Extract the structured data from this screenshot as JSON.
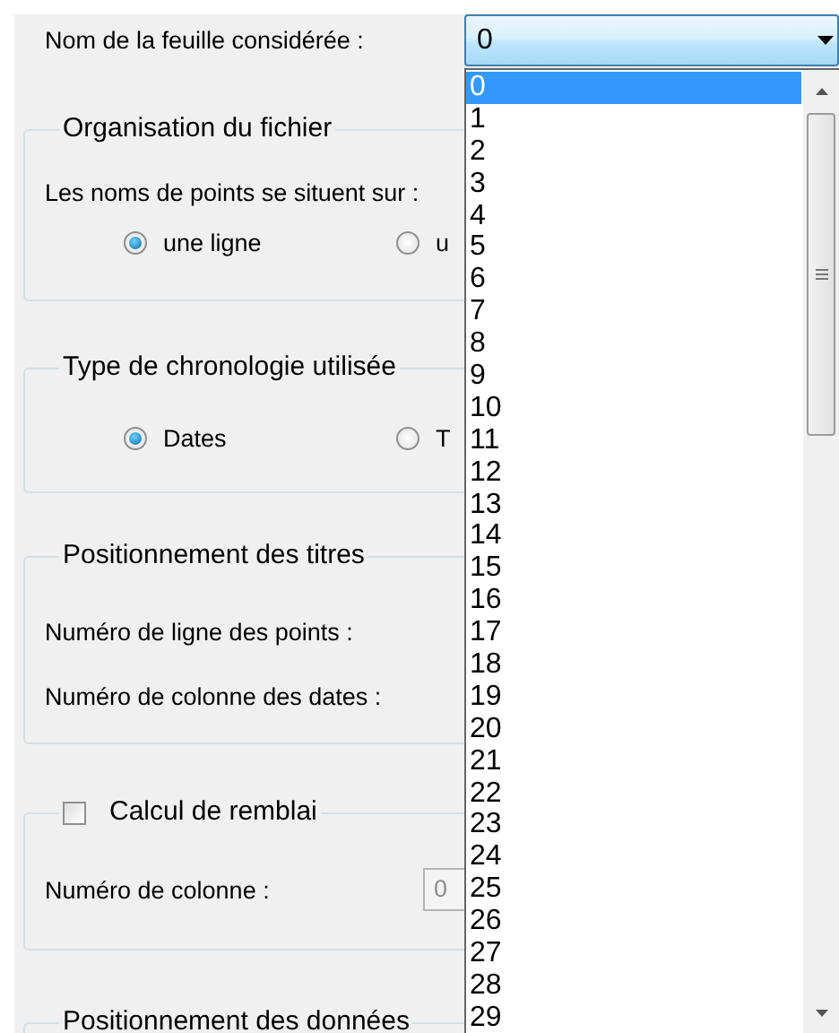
{
  "sheet_field": {
    "label": "Nom de la feuille considérée :",
    "value": "0",
    "expanded": true,
    "options": [
      {
        "label": "0",
        "selected": true
      },
      {
        "label": "1",
        "selected": false
      },
      {
        "label": "2",
        "selected": false
      },
      {
        "label": "3",
        "selected": false
      },
      {
        "label": "4",
        "selected": false
      },
      {
        "label": "5",
        "selected": false
      },
      {
        "label": "6",
        "selected": false
      },
      {
        "label": "7",
        "selected": false
      },
      {
        "label": "8",
        "selected": false
      },
      {
        "label": "9",
        "selected": false
      },
      {
        "label": "10",
        "selected": false
      },
      {
        "label": "11",
        "selected": false
      },
      {
        "label": "12",
        "selected": false
      },
      {
        "label": "13",
        "selected": false
      },
      {
        "label": "14",
        "selected": false
      },
      {
        "label": "15",
        "selected": false
      },
      {
        "label": "16",
        "selected": false
      },
      {
        "label": "17",
        "selected": false
      },
      {
        "label": "18",
        "selected": false
      },
      {
        "label": "19",
        "selected": false
      },
      {
        "label": "20",
        "selected": false
      },
      {
        "label": "21",
        "selected": false
      },
      {
        "label": "22",
        "selected": false
      },
      {
        "label": "23",
        "selected": false
      },
      {
        "label": "24",
        "selected": false
      },
      {
        "label": "25",
        "selected": false
      },
      {
        "label": "26",
        "selected": false
      },
      {
        "label": "27",
        "selected": false
      },
      {
        "label": "28",
        "selected": false
      },
      {
        "label": "29",
        "selected": false
      }
    ]
  },
  "groups": [
    {
      "kind": "radios",
      "title": "Organisation du fichier",
      "prompt": "Les noms de points se situent sur :",
      "options": [
        {
          "label": "une ligne",
          "selected": true
        },
        {
          "label": "u",
          "selected": false
        }
      ]
    },
    {
      "kind": "radios",
      "title": "Type de chronologie utilisée",
      "options": [
        {
          "label": "Dates",
          "selected": true
        },
        {
          "label": "T",
          "selected": false
        }
      ]
    },
    {
      "kind": "fields",
      "title": "Positionnement des titres",
      "rows": [
        {
          "label": "Numéro de ligne des points :"
        },
        {
          "label": "Numéro de colonne des dates :"
        }
      ]
    },
    {
      "kind": "check",
      "title": "Calcul de remblai",
      "checked": false,
      "rows": [
        {
          "label": "Numéro de colonne :",
          "value": "0",
          "disabled": true
        }
      ]
    },
    {
      "kind": "fields",
      "title": "Positionnement des données"
    }
  ]
}
